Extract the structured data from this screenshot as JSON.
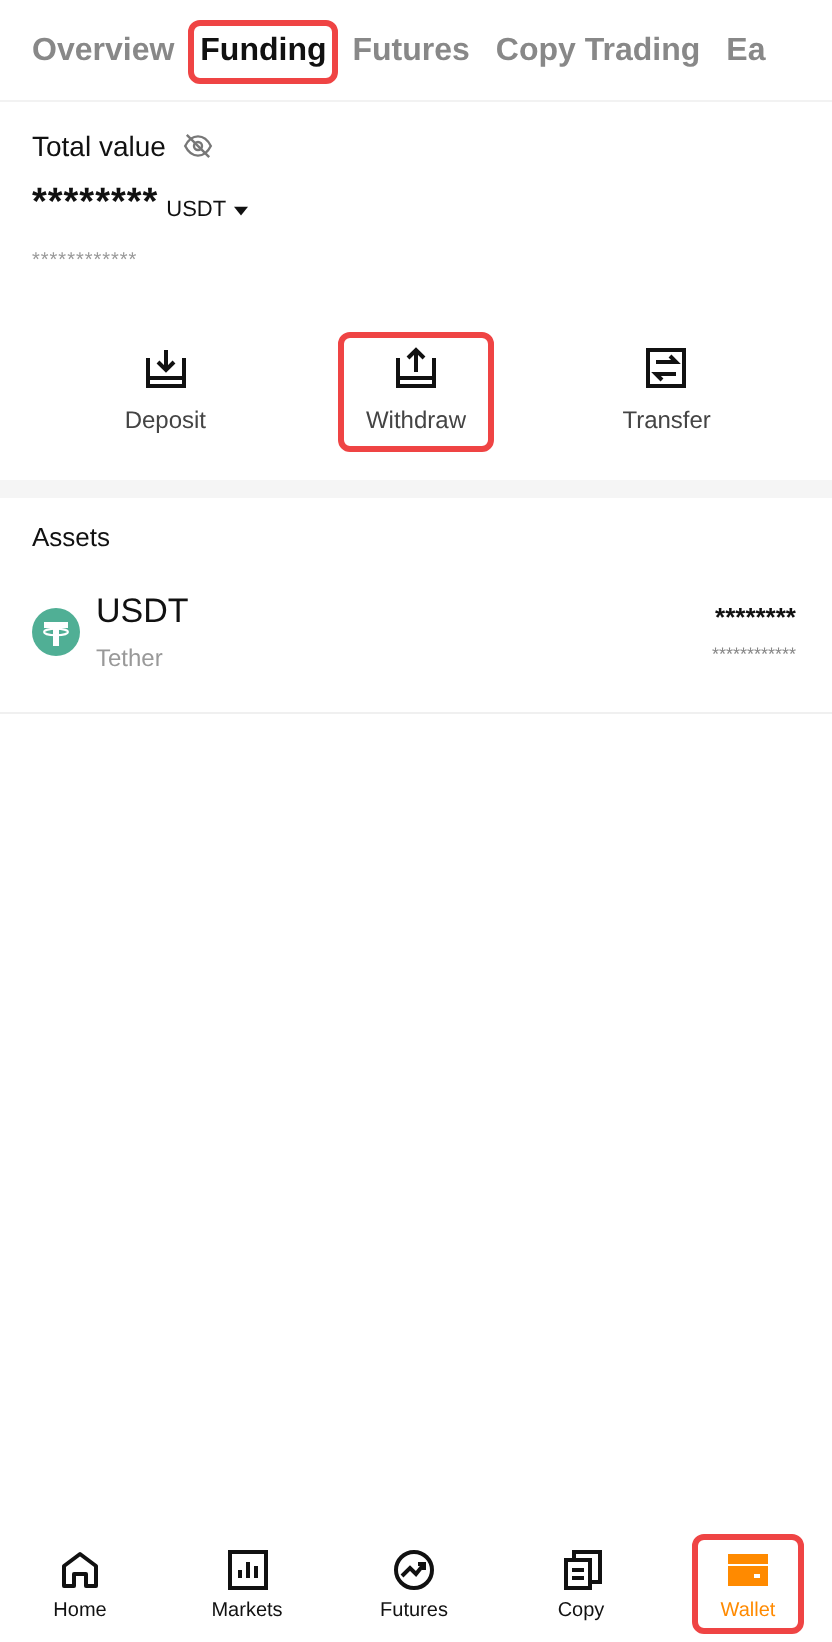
{
  "tabs": [
    {
      "label": "Overview",
      "selected": false,
      "highlighted": false
    },
    {
      "label": "Funding",
      "selected": true,
      "highlighted": true
    },
    {
      "label": "Futures",
      "selected": false,
      "highlighted": false
    },
    {
      "label": "Copy Trading",
      "selected": false,
      "highlighted": false
    },
    {
      "label": "Ea",
      "selected": false,
      "highlighted": false
    }
  ],
  "balance": {
    "label": "Total value",
    "value": "********",
    "currency": "USDT",
    "sub_value": "************"
  },
  "actions": [
    {
      "kind": "deposit",
      "label": "Deposit",
      "highlighted": false
    },
    {
      "kind": "withdraw",
      "label": "Withdraw",
      "highlighted": true
    },
    {
      "kind": "transfer",
      "label": "Transfer",
      "highlighted": false
    }
  ],
  "assets": {
    "title": "Assets",
    "rows": [
      {
        "symbol": "USDT",
        "name": "Tether",
        "amount": "********",
        "value": "************"
      }
    ]
  },
  "nav": [
    {
      "kind": "home",
      "label": "Home",
      "selected": false,
      "highlighted": false
    },
    {
      "kind": "markets",
      "label": "Markets",
      "selected": false,
      "highlighted": false
    },
    {
      "kind": "futures",
      "label": "Futures",
      "selected": false,
      "highlighted": false
    },
    {
      "kind": "copy",
      "label": "Copy",
      "selected": false,
      "highlighted": false
    },
    {
      "kind": "wallet",
      "label": "Wallet",
      "selected": true,
      "highlighted": true
    }
  ]
}
